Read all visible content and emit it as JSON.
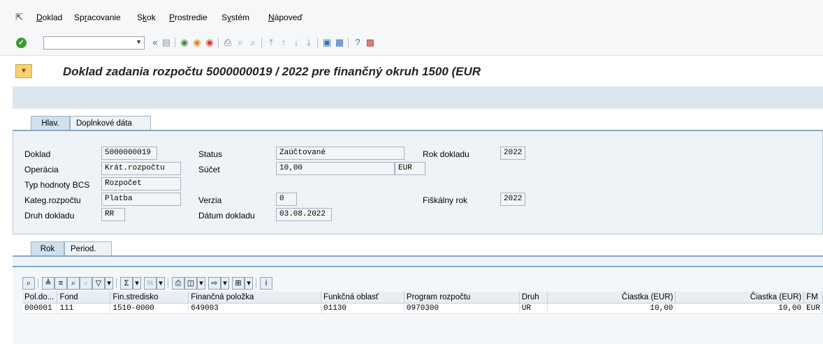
{
  "menu": {
    "items": [
      {
        "pre": "",
        "u": "D",
        "post": "oklad"
      },
      {
        "pre": "Sp",
        "u": "r",
        "post": "acovanie"
      },
      {
        "pre": "S",
        "u": "k",
        "post": "ok"
      },
      {
        "pre": "",
        "u": "P",
        "post": "rostredie"
      },
      {
        "pre": "S",
        "u": "y",
        "post": "stém"
      },
      {
        "pre": "",
        "u": "N",
        "post": "ápoveď"
      }
    ]
  },
  "toolbar": {
    "command_value": "",
    "icons": [
      "back-double-icon",
      "save-icon",
      "back-icon",
      "exit-icon",
      "cancel-icon",
      "print-icon",
      "find-icon",
      "find-next-icon",
      "first-page-icon",
      "prev-page-icon",
      "next-page-icon",
      "last-page-icon",
      "new-session-icon",
      "shortcut-icon",
      "help-icon",
      "layout-icon"
    ]
  },
  "title": "Doklad zadania rozpočtu 5000000019 / 2022 pre finančný okruh 1500 (EUR",
  "header_tabs": [
    "Hlav.",
    "Doplnkové dáta"
  ],
  "header": {
    "doklad": {
      "label": "Doklad",
      "value": "5000000019"
    },
    "operacia": {
      "label": "Operácia",
      "value": "Krát.rozpočtu"
    },
    "typ_hodnoty": {
      "label": "Typ hodnoty BCS",
      "value": "Rozpočet"
    },
    "kateg": {
      "label": "Kateg.rozpočtu",
      "value": "Platba"
    },
    "druh_dokladu": {
      "label": "Druh dokladu",
      "value": "RR"
    },
    "status": {
      "label": "Status",
      "value": "Zaúčtované"
    },
    "sucet": {
      "label": "Súčet",
      "value": "10,00",
      "currency": "EUR"
    },
    "verzia": {
      "label": "Verzia",
      "value": "0"
    },
    "datum": {
      "label": "Dátum dokladu",
      "value": "03.08.2022"
    },
    "rok_dokladu": {
      "label": "Rok dokladu",
      "value": "2022"
    },
    "fiskalny_rok": {
      "label": "Fiškálny rok",
      "value": "2022"
    }
  },
  "lower_tabs": [
    "Rok",
    "Period."
  ],
  "grid": {
    "columns": [
      "Pol.do...",
      "Fond",
      "Fin.stredisko",
      "Finančná položka",
      "Funkčná oblasť",
      "Program rozpočtu",
      "Druh",
      "Čiastka (EUR)",
      "Čiastka (EUR)",
      "FM"
    ],
    "rows": [
      [
        "000001",
        "111",
        "1510-0000",
        "649003",
        "01130",
        "0970300",
        "UR",
        "10,00",
        "10,00",
        "EUR"
      ]
    ]
  }
}
